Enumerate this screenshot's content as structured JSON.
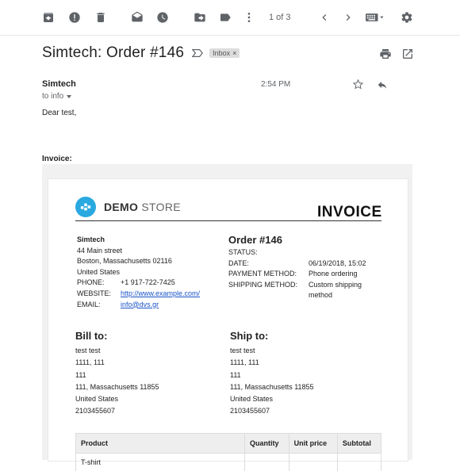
{
  "toolbar": {
    "icons": [
      "archive-icon",
      "report-spam-icon",
      "delete-icon",
      "mark-unread-icon",
      "snooze-icon",
      "move-to-icon",
      "label-icon",
      "more-icon",
      "prev-icon",
      "next-icon",
      "input-tools-icon",
      "settings-icon"
    ],
    "pager": "1 of 3"
  },
  "email": {
    "subject": "Simtech: Order #146",
    "label": "Inbox",
    "label_close": "×",
    "sender": "Simtech",
    "to": "to info",
    "time": "2:54 PM",
    "greeting": "Dear test,",
    "invoice_heading": "Invoice:"
  },
  "invoice": {
    "logo_bold": "DEMO",
    "logo_light": " STORE",
    "title": "INVOICE",
    "store": {
      "name": "Simtech",
      "address1": "44 Main street",
      "address2": "Boston, Massachusetts 02116",
      "country": "United States",
      "phone_label": "PHONE:",
      "phone": "+1 917-722-7425",
      "website_label": "WEBSITE:",
      "website": "http://www.example.com/",
      "email_label": "EMAIL:",
      "email": "info@dvs.gr"
    },
    "order": {
      "title": "Order #146",
      "status_label": "STATUS:",
      "status": "",
      "date_label": "DATE:",
      "date": "06/19/2018, 15:02",
      "payment_label": "PAYMENT METHOD:",
      "payment": "Phone ordering",
      "shipping_label": "SHIPPING METHOD:",
      "shipping": "Custom shipping method"
    },
    "bill_to": {
      "heading": "Bill to:",
      "name": "test test",
      "line1": "1111, 111",
      "line2": "111",
      "line3": "111, Massachusetts 11855",
      "country": "United States",
      "phone": "2103455607"
    },
    "ship_to": {
      "heading": "Ship to:",
      "name": "test test",
      "line1": "1111, 111",
      "line2": "111",
      "line3": "111, Massachusetts 11855",
      "country": "United States",
      "phone": "2103455607"
    },
    "table": {
      "headers": [
        "Product",
        "Quantity",
        "Unit price",
        "Subtotal"
      ],
      "rows": [
        [
          "T-shirt",
          "",
          "",
          ""
        ]
      ]
    }
  }
}
